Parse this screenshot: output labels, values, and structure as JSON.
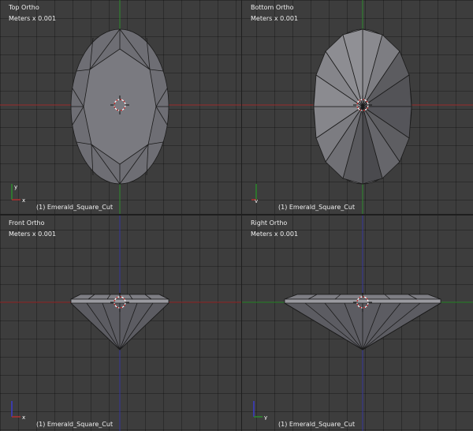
{
  "viewports": {
    "top": {
      "title": "Top Ortho",
      "units": "Meters x 0.001",
      "object": "(1) Emerald_Square_Cut"
    },
    "bottom": {
      "title": "Bottom Ortho",
      "units": "Meters x 0.001",
      "object": "(1) Emerald_Square_Cut"
    },
    "front": {
      "title": "Front Ortho",
      "units": "Meters x 0.001",
      "object": "(1) Emerald_Square_Cut"
    },
    "right": {
      "title": "Right Ortho",
      "units": "Meters x 0.001",
      "object": "(1) Emerald_Square_Cut"
    }
  },
  "colors": {
    "viewport_bg": "#3d3d3d",
    "axis_red": "#9a2a2a",
    "axis_green": "#2d8a2d",
    "axis_blue": "#35359a",
    "mesh_face": "#6e6e74",
    "mesh_edge": "#1a1a1a"
  }
}
